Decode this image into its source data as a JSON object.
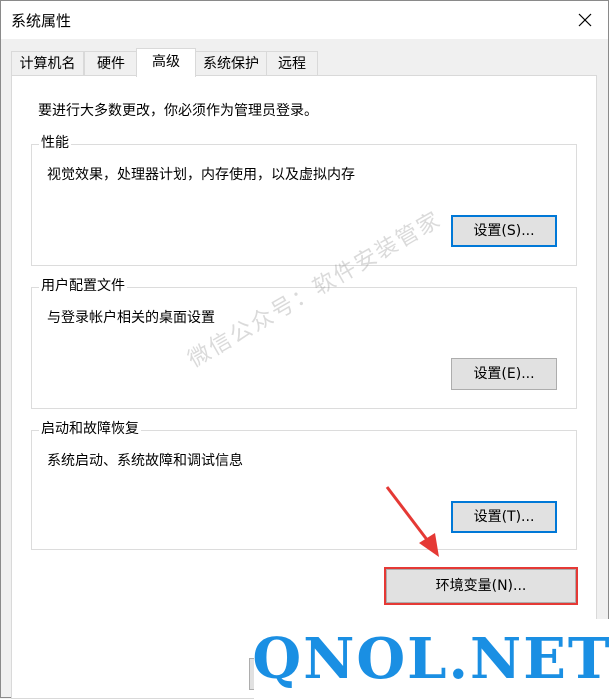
{
  "window": {
    "title": "系统属性"
  },
  "tabs": [
    {
      "label": "计算机名",
      "active": false
    },
    {
      "label": "硬件",
      "active": false
    },
    {
      "label": "高级",
      "active": true
    },
    {
      "label": "系统保护",
      "active": false
    },
    {
      "label": "远程",
      "active": false
    }
  ],
  "advanced": {
    "admin_note": "要进行大多数更改，你必须作为管理员登录。",
    "performance": {
      "title": "性能",
      "description": "视觉效果，处理器计划，内存使用，以及虚拟内存",
      "button": "设置(S)..."
    },
    "user_profiles": {
      "title": "用户配置文件",
      "description": "与登录帐户相关的桌面设置",
      "button": "设置(E)..."
    },
    "startup_recovery": {
      "title": "启动和故障恢复",
      "description": "系统启动、系统故障和调试信息",
      "button": "设置(T)..."
    },
    "env_button": "环境变量(N)..."
  },
  "overlay": {
    "watermark": "微信公众号：软件安装管家",
    "brand": "QNOL.NET",
    "highlight_color": "#e53935",
    "brand_color": "#1a8fe3"
  },
  "icons": {
    "close": "close-icon"
  }
}
